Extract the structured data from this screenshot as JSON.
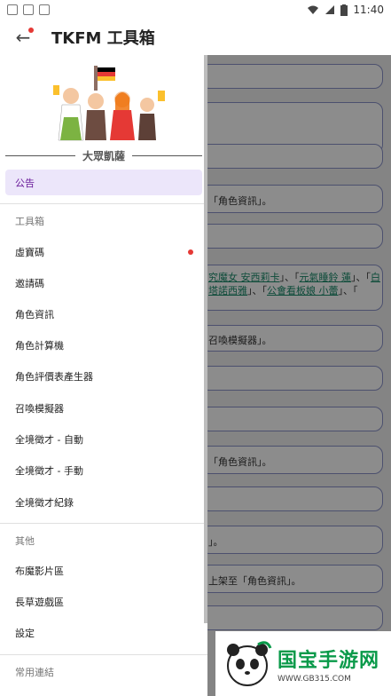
{
  "status": {
    "time": "11:40"
  },
  "appbar": {
    "title": "TKFM 工具箱"
  },
  "hero": {
    "label": "大眾凱薩"
  },
  "drawer": {
    "announce": "公告",
    "tools_header": "工具箱",
    "tools": [
      "虛寶碼",
      "邀請碼",
      "角色資訊",
      "角色計算機",
      "角色評價表產生器",
      "召喚模擬器",
      "全境徵才 - 自動",
      "全境徵才 - 手動",
      "全境徵才紀錄"
    ],
    "other_header": "其他",
    "other": [
      "布魔影片區",
      "長草遊戲區",
      "設定"
    ],
    "links_header": "常用連結"
  },
  "background": {
    "card_a": "「角色資訊」。",
    "card_b1": "究魔女 安西莉卡",
    "card_b2": "」、「",
    "card_b3": "元氣睡鈴 蓮",
    "card_b4": "」、「",
    "card_b5": "白",
    "card_b6": "塔諾西雅",
    "card_b7": "」、「",
    "card_b8": "公會看板娘 小蕾",
    "card_b9": "」、「",
    "card_c": "召喚模擬器」。",
    "card_d": "「角色資訊」。",
    "card_e": "」。",
    "card_f": "上架至「角色資訊」。"
  },
  "watermark": {
    "title": "国宝手游网",
    "url": "WWW.GB315.COM"
  },
  "colors": {
    "accent": "#6a1b9a",
    "selected_bg": "#ece6fa",
    "badge": "#e53935"
  }
}
